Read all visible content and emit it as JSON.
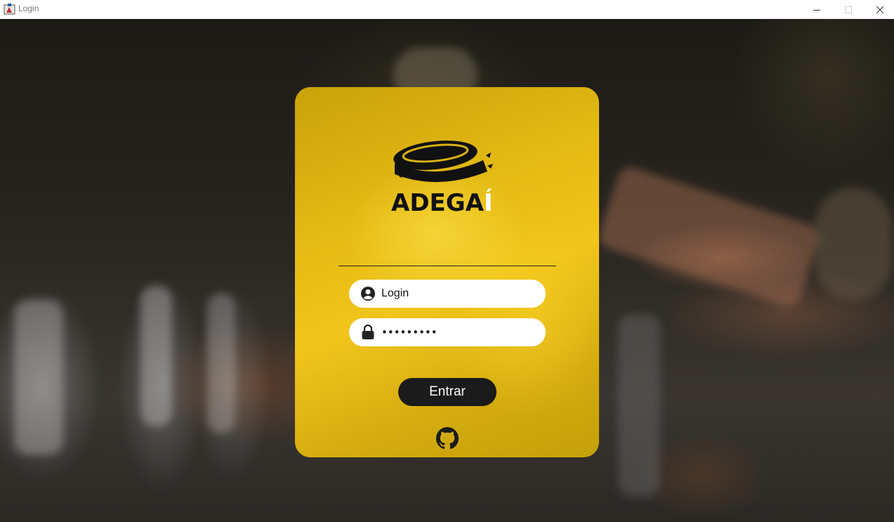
{
  "window": {
    "title": "Login",
    "icons": {
      "app": "java-app-icon",
      "minimize": "minimize-icon",
      "maximize": "maximize-icon",
      "close": "close-icon"
    }
  },
  "card": {
    "logo_text": "ADEGA",
    "logo_accent": "Í",
    "login_field": {
      "placeholder": "Login",
      "value": ""
    },
    "password_field": {
      "value": "•••••••••"
    },
    "submit_label": "Entrar",
    "icons": {
      "user": "user-circle-icon",
      "lock": "lock-icon",
      "github": "github-icon",
      "logo": "bottle-cap-icon"
    }
  },
  "colors": {
    "card_accent": "#e6bb14",
    "button_bg": "#1b1b1b",
    "button_text": "#ffffff"
  }
}
